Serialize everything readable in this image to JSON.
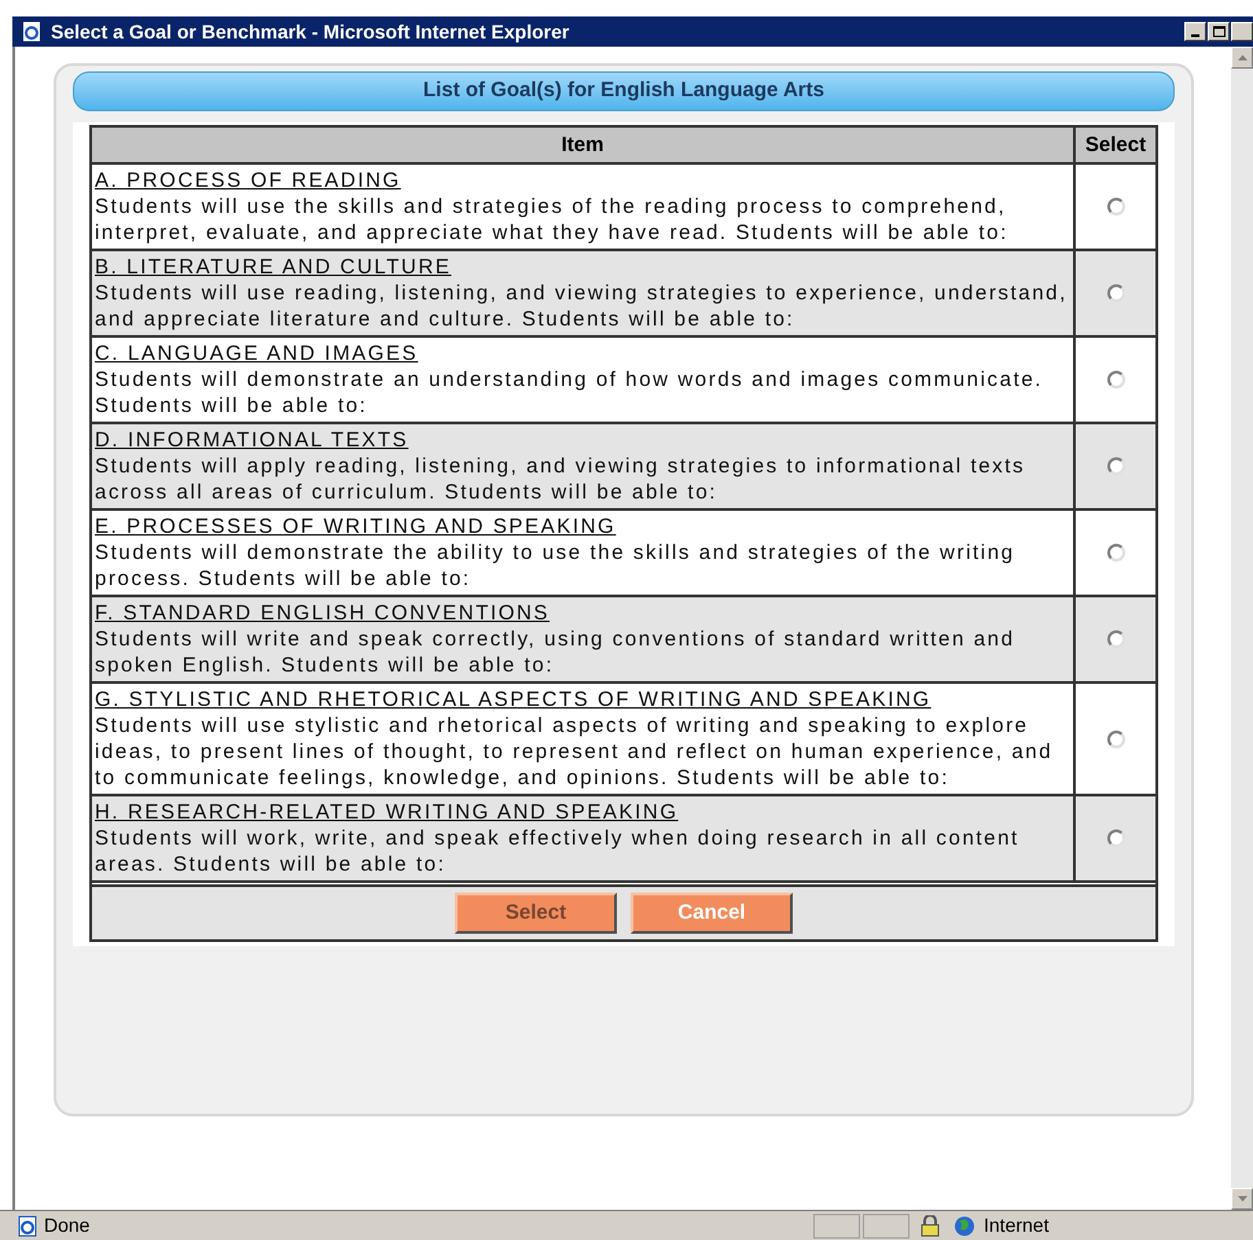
{
  "window": {
    "title": "Select a Goal or Benchmark - Microsoft Internet Explorer"
  },
  "panel": {
    "title": "List of Goal(s) for English Language Arts"
  },
  "table": {
    "columns": [
      "Item",
      "Select"
    ],
    "rows": [
      {
        "title": "A. PROCESS OF READING",
        "description": "Students will use the skills and strategies of the reading process to comprehend, interpret, evaluate, and appreciate what they have read. Students will be able to:",
        "selected": false
      },
      {
        "title": "B. LITERATURE AND CULTURE",
        "description": "Students will use reading, listening, and viewing strategies to experience, understand, and appreciate literature and culture. Students will be able to:",
        "selected": false
      },
      {
        "title": "C. LANGUAGE AND IMAGES",
        "description": "Students will demonstrate an understanding of how words and images communicate. Students will be able to:",
        "selected": false
      },
      {
        "title": "D. INFORMATIONAL TEXTS",
        "description": "Students will apply reading, listening, and viewing strategies to informational texts across all areas of curriculum. Students will be able to:",
        "selected": false
      },
      {
        "title": "E. PROCESSES OF WRITING AND SPEAKING",
        "description": "Students will demonstrate the ability to use the skills and strategies of the writing process. Students will be able to:",
        "selected": false
      },
      {
        "title": "F. STANDARD ENGLISH CONVENTIONS",
        "description": "Students will write and speak correctly, using conventions of standard written and spoken English. Students will be able to:",
        "selected": false
      },
      {
        "title": "G. STYLISTIC AND RHETORICAL ASPECTS OF WRITING AND SPEAKING",
        "description": "Students will use stylistic and rhetorical aspects of writing and speaking to explore ideas, to present lines of thought, to represent and reflect on human experience, and to communicate feelings, knowledge, and opinions. Students will be able to:",
        "selected": false
      },
      {
        "title": "H. RESEARCH-RELATED WRITING AND SPEAKING",
        "description": "Students will work, write, and speak effectively when doing research in all content areas. Students will be able to:",
        "selected": false
      }
    ]
  },
  "buttons": [
    {
      "label": "Select",
      "disabled": true
    },
    {
      "label": "Cancel",
      "disabled": false
    }
  ],
  "status_bar": {
    "status": "Done",
    "zone": "Internet"
  }
}
